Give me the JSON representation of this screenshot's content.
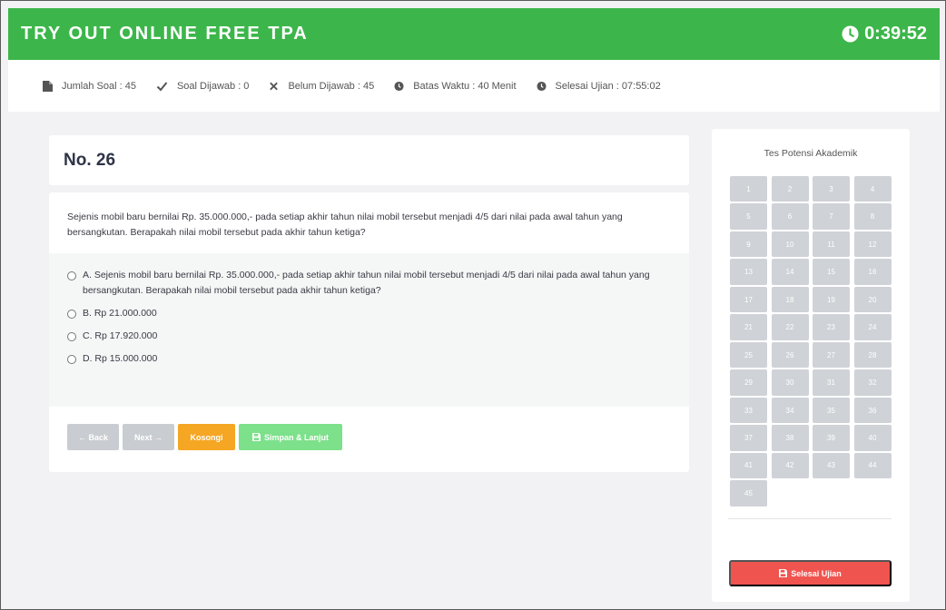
{
  "header": {
    "title": "TRY OUT ONLINE FREE TPA",
    "timer": "0:39:52",
    "icon": "clock-icon",
    "color": "#3cb64a"
  },
  "infobar": {
    "total": "Jumlah Soal : 45",
    "answered": "Soal Dijawab : 0",
    "unanswered": "Belum Dijawab : 45",
    "time_limit": "Batas Waktu : 40 Menit",
    "finish_time": "Selesai Ujian : 07:55:02"
  },
  "question": {
    "number": "No. 26",
    "text": "Sejenis mobil baru bernilai Rp. 35.000.000,- pada setiap akhir tahun nilai mobil tersebut menjadi 4/5 dari nilai pada awal tahun yang bersangkutan. Berapakah nilai mobil tersebut pada akhir tahun ketiga?",
    "options": [
      "A. Sejenis mobil baru bernilai Rp. 35.000.000,- pada setiap akhir tahun nilai mobil tersebut menjadi 4/5 dari nilai pada awal tahun yang bersangkutan. Berapakah nilai mobil tersebut pada akhir tahun ketiga?",
      "B. Rp 21.000.000",
      "C. Rp 17.920.000",
      "D. Rp 15.000.000"
    ]
  },
  "buttons": {
    "back": "← Back",
    "next": "Next →",
    "empty": "Kosongi",
    "save": "Simpan & Lanjut"
  },
  "sidebar": {
    "title": "Tes Potensi Akademik",
    "numbers": [
      "1",
      "2",
      "3",
      "4",
      "5",
      "6",
      "7",
      "8",
      "9",
      "10",
      "11",
      "12",
      "13",
      "14",
      "15",
      "16",
      "17",
      "18",
      "19",
      "20",
      "21",
      "22",
      "23",
      "24",
      "25",
      "26",
      "27",
      "28",
      "29",
      "30",
      "31",
      "32",
      "33",
      "34",
      "35",
      "36",
      "37",
      "38",
      "39",
      "40",
      "41",
      "42",
      "43",
      "44",
      "45"
    ],
    "finish": "Selesai Ujian",
    "finish_color": "#f0544f"
  }
}
